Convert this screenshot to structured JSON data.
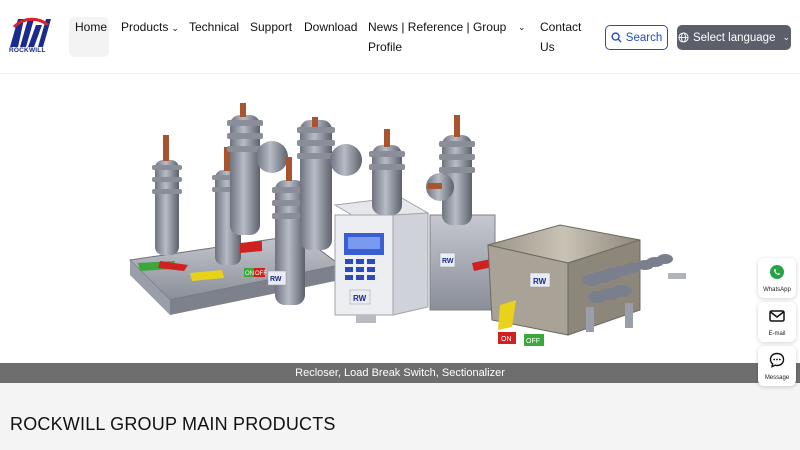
{
  "header": {
    "logo_text": "ROCKWILL",
    "nav": [
      {
        "label": "Home",
        "has_dropdown": false
      },
      {
        "label": "Products",
        "has_dropdown": true
      },
      {
        "label": "Technical",
        "has_dropdown": false
      },
      {
        "label": "Support",
        "has_dropdown": false
      },
      {
        "label": "Download",
        "has_dropdown": false
      },
      {
        "label_line1": "News | Reference | Group",
        "label_line2": "Profile",
        "has_dropdown": true
      },
      {
        "label_line1": "Contact",
        "label_line2": "Us",
        "has_dropdown": false
      }
    ],
    "search_label": "Search",
    "language_label": "Select language"
  },
  "hero": {
    "caption": "Recloser, Load Break Switch, Sectionalizer",
    "panel_brand": "RW",
    "on_label": "ON",
    "off_label": "OFF"
  },
  "section": {
    "title": "ROCKWILL GROUP MAIN PRODUCTS"
  },
  "floating_contacts": [
    {
      "label": "WhatsApp",
      "icon": "whatsapp-icon",
      "color": "#25a244"
    },
    {
      "label": "E-mail",
      "icon": "email-icon",
      "color": "#111111"
    },
    {
      "label": "Message",
      "icon": "message-icon",
      "color": "#111111"
    }
  ],
  "colors": {
    "accent": "#1e4fbf",
    "language_button": "#5b5f6a",
    "caption_bar": "#6e6e6e"
  }
}
